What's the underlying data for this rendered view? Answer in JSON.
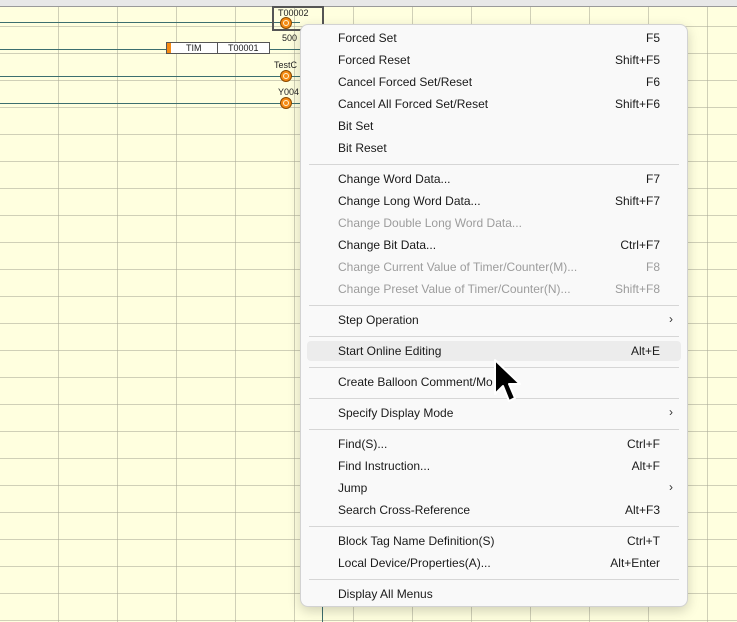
{
  "ladder": {
    "device_labels": {
      "coil1": "T00002",
      "preset": "500",
      "coil3": "TestC",
      "coil4": "Y004"
    },
    "tim_block": {
      "instruction": "TIM",
      "operand": "T00001"
    }
  },
  "context_menu": {
    "items": [
      {
        "label": "Forced Set",
        "shortcut": "F5",
        "enabled": true
      },
      {
        "label": "Forced Reset",
        "shortcut": "Shift+F5",
        "enabled": true
      },
      {
        "label": "Cancel Forced Set/Reset",
        "shortcut": "F6",
        "enabled": true
      },
      {
        "label": "Cancel All Forced Set/Reset",
        "shortcut": "Shift+F6",
        "enabled": true
      },
      {
        "label": "Bit Set",
        "shortcut": "",
        "enabled": true
      },
      {
        "label": "Bit Reset",
        "shortcut": "",
        "enabled": true
      },
      {
        "label": "Change Word Data...",
        "shortcut": "F7",
        "enabled": true
      },
      {
        "label": "Change Long Word Data...",
        "shortcut": "Shift+F7",
        "enabled": true
      },
      {
        "label": "Change Double Long Word Data...",
        "shortcut": "",
        "enabled": false
      },
      {
        "label": "Change Bit Data...",
        "shortcut": "Ctrl+F7",
        "enabled": true
      },
      {
        "label": "Change Current Value of Timer/Counter(M)...",
        "shortcut": "F8",
        "enabled": false
      },
      {
        "label": "Change Preset Value of Timer/Counter(N)...",
        "shortcut": "Shift+F8",
        "enabled": false
      },
      {
        "label": "Step Operation",
        "shortcut": "",
        "enabled": true,
        "submenu": true
      },
      {
        "label": "Start Online Editing",
        "shortcut": "Alt+E",
        "enabled": true,
        "highlighted": true
      },
      {
        "label": "Create Balloon Comment/Mo",
        "shortcut": "",
        "enabled": true
      },
      {
        "label": "Specify Display Mode",
        "shortcut": "",
        "enabled": true,
        "submenu": true
      },
      {
        "label": "Find(S)...",
        "shortcut": "Ctrl+F",
        "enabled": true
      },
      {
        "label": "Find Instruction...",
        "shortcut": "Alt+F",
        "enabled": true
      },
      {
        "label": "Jump",
        "shortcut": "",
        "enabled": true,
        "submenu": true
      },
      {
        "label": "Search Cross-Reference",
        "shortcut": "Alt+F3",
        "enabled": true
      },
      {
        "label": "Block Tag Name Definition(S)",
        "shortcut": "Ctrl+T",
        "enabled": true
      },
      {
        "label": "Local Device/Properties(A)...",
        "shortcut": "Alt+Enter",
        "enabled": true
      },
      {
        "label": "Display All Menus",
        "shortcut": "",
        "enabled": true
      }
    ],
    "submenu_glyph": "›",
    "colors": {
      "background": "#f9f9f9",
      "disabled_text": "#9c9c9c",
      "highlight": "#ececec"
    }
  }
}
